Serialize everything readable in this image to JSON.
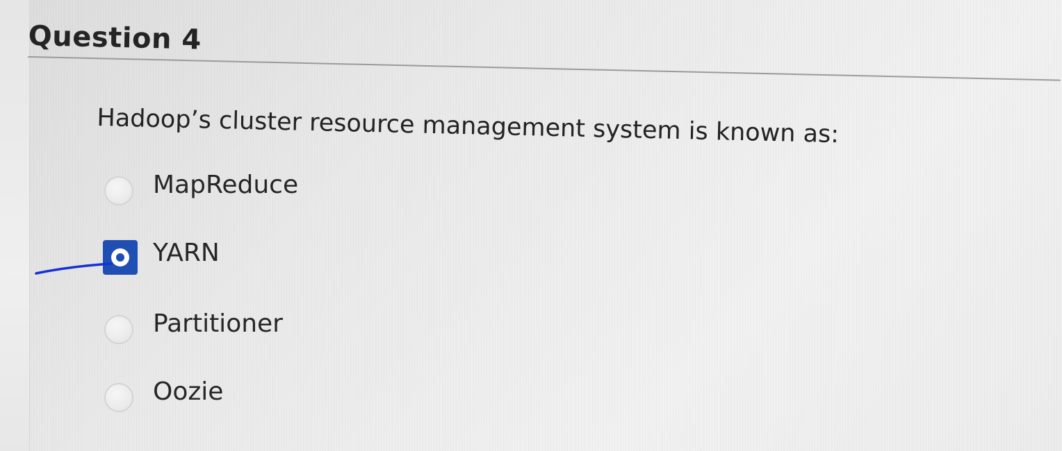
{
  "question": {
    "title": "Question 4",
    "text": "Hadoop’s cluster resource management system is known as:",
    "selected_option": "YARN",
    "options": [
      {
        "label": "MapReduce",
        "checked": false
      },
      {
        "label": "YARN",
        "checked": true
      },
      {
        "label": "Partitioner",
        "checked": false
      },
      {
        "label": "Oozie",
        "checked": false
      }
    ]
  },
  "colors": {
    "selected_radio": "#1f4fb2",
    "pen_mark": "#1530d8"
  }
}
